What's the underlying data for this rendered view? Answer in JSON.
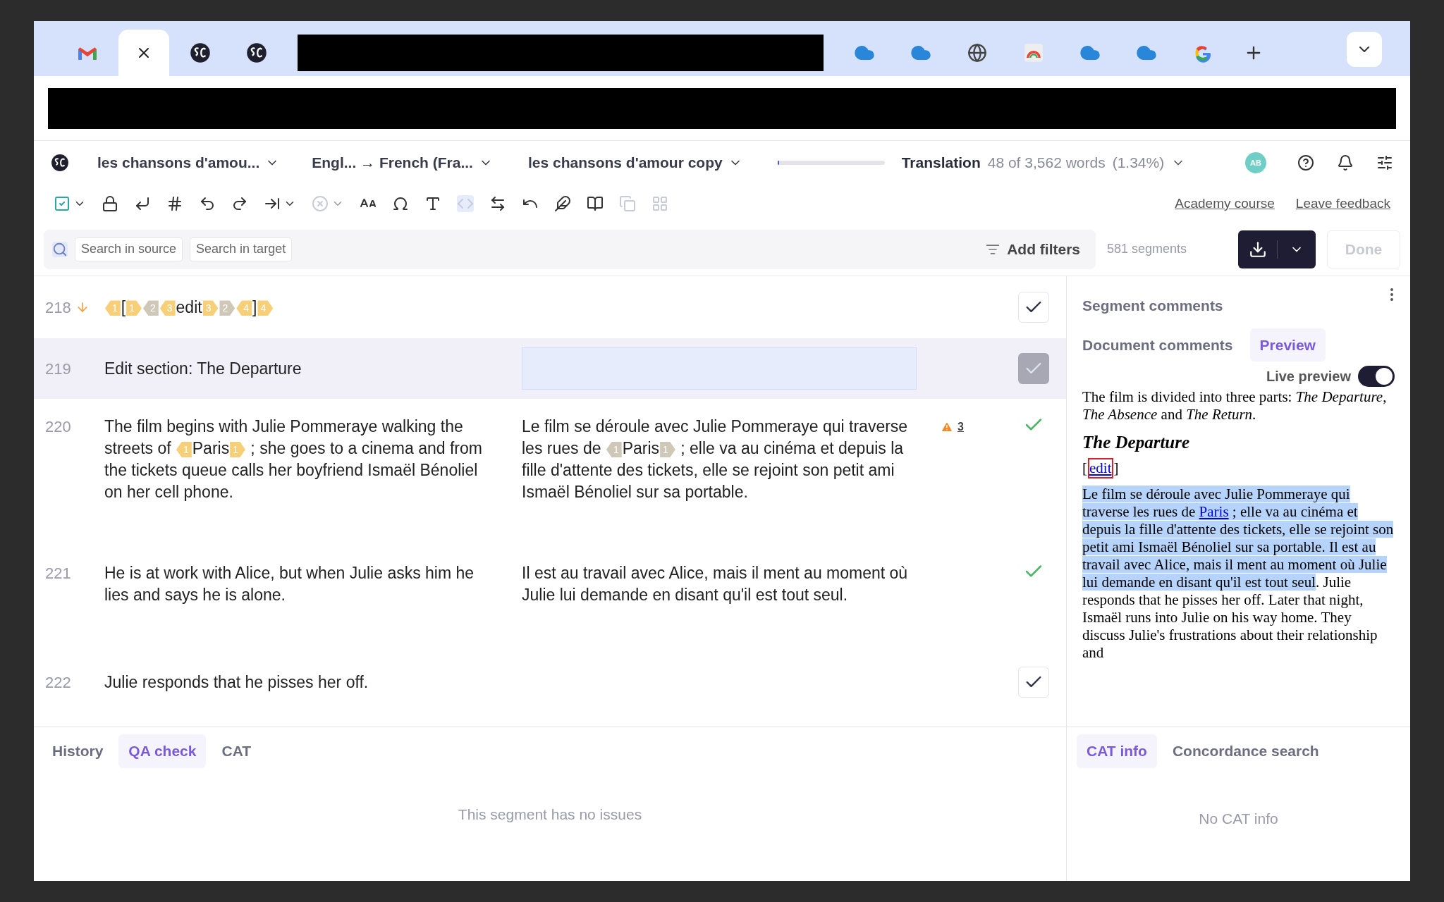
{
  "browser_tabs": [
    {
      "kind": "gmail",
      "selected": false
    },
    {
      "kind": "close",
      "selected": true
    },
    {
      "kind": "logo",
      "selected": false
    },
    {
      "kind": "logo",
      "selected": false
    },
    {
      "kind": "redacted",
      "selected": false
    },
    {
      "kind": "cloud",
      "selected": false
    },
    {
      "kind": "cloud",
      "selected": false
    },
    {
      "kind": "globe",
      "selected": false
    },
    {
      "kind": "chrome",
      "selected": false
    },
    {
      "kind": "cloud",
      "selected": false
    },
    {
      "kind": "cloud",
      "selected": false
    },
    {
      "kind": "google",
      "selected": false
    }
  ],
  "header": {
    "project": "les chansons d'amou...",
    "languages": "Engl... → French (Fra...",
    "document": "les chansons d'amour copy",
    "progress": {
      "level": 0.0134
    },
    "step": "Translation",
    "words": "48 of 3,562 words",
    "percent": "(1.34%)",
    "avatar": "AB"
  },
  "toolbar": {
    "tools": [
      {
        "kind": "confirm",
        "disabled": false,
        "menu": true
      },
      {
        "kind": "lock",
        "disabled": false,
        "menu": false
      },
      {
        "kind": "enter",
        "disabled": false,
        "menu": false
      },
      {
        "kind": "hash",
        "disabled": false,
        "menu": false
      },
      {
        "kind": "undo",
        "disabled": false,
        "menu": false
      },
      {
        "kind": "redo",
        "disabled": false,
        "menu": false
      },
      {
        "kind": "wrap",
        "disabled": false,
        "menu": true
      },
      {
        "kind": "clear",
        "disabled": true,
        "menu": true
      },
      {
        "kind": "case",
        "disabled": false,
        "menu": false
      },
      {
        "kind": "omega",
        "disabled": false,
        "menu": false
      },
      {
        "kind": "text-size",
        "disabled": false,
        "menu": false
      },
      {
        "kind": "code",
        "disabled": true,
        "menu": false
      },
      {
        "kind": "swap",
        "disabled": false,
        "menu": false
      },
      {
        "kind": "revert",
        "disabled": false,
        "menu": false
      },
      {
        "kind": "feather",
        "disabled": false,
        "menu": false
      },
      {
        "kind": "book",
        "disabled": false,
        "menu": false
      },
      {
        "kind": "copy",
        "disabled": true,
        "menu": false
      },
      {
        "kind": "grid",
        "disabled": true,
        "menu": false
      }
    ],
    "links": [
      "Academy course",
      "Leave feedback"
    ]
  },
  "search": {
    "chips": [
      "Search in source",
      "Search in target"
    ],
    "filters": "Add filters",
    "count": "581 segments",
    "done": {
      "label": "Done",
      "disabled": true
    }
  },
  "segments": [
    {
      "number": "218",
      "marked": true,
      "selected": false,
      "editing": false,
      "confirmed": false,
      "disabled": false,
      "source": [
        {
          "kind": "tag-open",
          "text": "1",
          "muted": false
        },
        {
          "kind": "text",
          "text": "["
        },
        {
          "kind": "tag-close",
          "text": "1",
          "muted": false
        },
        {
          "kind": "tag-open",
          "text": "2",
          "muted": true
        },
        {
          "kind": "tag-open",
          "text": "3",
          "muted": false
        },
        {
          "kind": "text",
          "text": "edit"
        },
        {
          "kind": "tag-close",
          "text": "3",
          "muted": false
        },
        {
          "kind": "tag-close",
          "text": "2",
          "muted": true
        },
        {
          "kind": "tag-open",
          "text": "4",
          "muted": false
        },
        {
          "kind": "text",
          "text": "]"
        },
        {
          "kind": "tag-close",
          "text": "4",
          "muted": false
        }
      ]
    },
    {
      "number": "219",
      "marked": false,
      "selected": true,
      "editing": true,
      "confirmed": false,
      "disabled": true,
      "source": [
        {
          "kind": "text",
          "text": "Edit section: The Departure"
        }
      ]
    },
    {
      "number": "220",
      "marked": false,
      "selected": false,
      "editing": false,
      "confirmed": true,
      "disabled": false,
      "warnings": "3",
      "source": [
        {
          "kind": "text",
          "text": "The film begins with Julie Pommeraye walking the streets of "
        },
        {
          "kind": "tag-open",
          "text": "1",
          "muted": false
        },
        {
          "kind": "text",
          "text": "Paris"
        },
        {
          "kind": "tag-close",
          "text": "1",
          "muted": false
        },
        {
          "kind": "text",
          "text": " ; she goes to a cinema and from the tickets queue calls her boyfriend Ismaël Bénoliel on her cell phone."
        }
      ],
      "target": [
        {
          "kind": "text",
          "text": "Le film se déroule avec Julie Pommeraye qui traverse les rues de "
        },
        {
          "kind": "tag-open",
          "text": "1",
          "muted": true
        },
        {
          "kind": "text",
          "text": "Paris"
        },
        {
          "kind": "tag-close",
          "text": "1",
          "muted": true
        },
        {
          "kind": "text",
          "text": " ; elle va au cinéma et depuis la fille d'attente des tickets, elle se rejoint son petit ami Ismaël Bénoliel sur sa portable."
        }
      ]
    },
    {
      "number": "221",
      "marked": false,
      "selected": false,
      "editing": false,
      "confirmed": true,
      "disabled": false,
      "source": [
        {
          "kind": "text",
          "text": "He is at work with Alice, but when Julie asks him he lies and says he is alone."
        }
      ],
      "target": [
        {
          "kind": "text",
          "text": "Il est au travail avec Alice, mais il ment au moment où Julie lui demande en disant qu'il est tout seul."
        }
      ]
    },
    {
      "number": "222",
      "marked": false,
      "selected": false,
      "editing": false,
      "confirmed": false,
      "disabled": false,
      "source": [
        {
          "kind": "text",
          "text": "Julie responds that he pisses her off."
        }
      ]
    }
  ],
  "side_panel": {
    "tabs": [
      {
        "label": "Segment comments",
        "selected": false
      },
      {
        "label": "Document comments",
        "selected": false
      },
      {
        "label": "Preview",
        "selected": true
      }
    ],
    "live_preview": {
      "label": "Live preview",
      "on": true
    },
    "preview": {
      "intro": "The film is divided into three parts: *The Departure*, *The Absence* and *The Return*.",
      "heading": "The Departure",
      "edit_link": "edit",
      "bracket_open": "[",
      "bracket_close": "]",
      "paragraph": {
        "highlighted_before": "Le film se déroule avec Julie Pommeraye qui traverse les rues de ",
        "link": "Paris",
        "highlighted_after": " ; elle va au cinéma et depuis la fille d'attente des tickets, elle se rejoint son petit ami Ismaël Bénoliel sur sa portable.  Il est au travail avec Alice, mais il ment au moment où Julie lui demande en disant qu'il est tout seul",
        "rest": ". Julie responds that he pisses her off. Later that night, Ismaël runs into Julie on his way home. They discuss Julie's frustrations about their relationship and"
      }
    }
  },
  "bottom_panel": {
    "tabs": [
      {
        "label": "History",
        "selected": false
      },
      {
        "label": "QA check",
        "selected": true
      },
      {
        "label": "CAT",
        "selected": false
      }
    ],
    "message": "This segment has no issues"
  },
  "cat_panel": {
    "tabs": [
      {
        "label": "CAT info",
        "selected": true
      },
      {
        "label": "Concordance search",
        "selected": false
      }
    ],
    "message": "No CAT info"
  }
}
